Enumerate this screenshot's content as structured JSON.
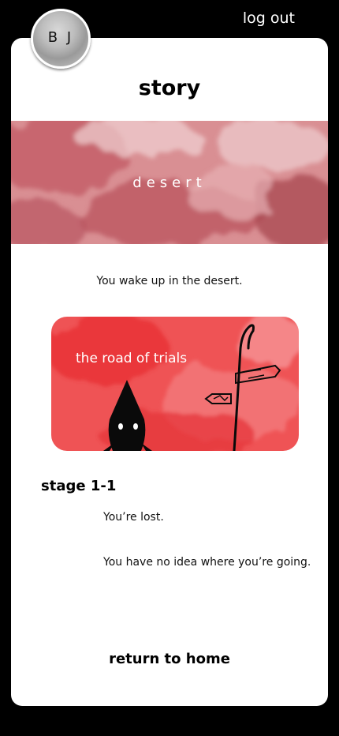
{
  "header": {
    "logout_label": "log out"
  },
  "user": {
    "initials": "B J"
  },
  "page": {
    "title": "story"
  },
  "location": {
    "label": "desert",
    "intro_text": "You wake up in the desert."
  },
  "chapter": {
    "title": "the road of trials"
  },
  "stage": {
    "title": "stage 1-1",
    "lines": [
      "You’re lost.",
      "You have no idea where you’re going."
    ]
  },
  "footer": {
    "home_label": "return to home"
  },
  "colors": {
    "background": "#000000",
    "card": "#ffffff",
    "banner_red": "#c9606a",
    "chapter_red": "#ea3a3e"
  },
  "icons": {
    "avatar": "user-photo",
    "chapter_art": "hooded-figure-with-signpost-icon"
  }
}
